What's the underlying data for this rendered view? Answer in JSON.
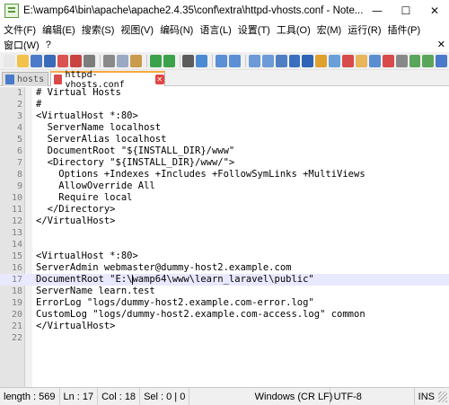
{
  "window": {
    "title": "E:\\wamp64\\bin\\apache\\apache2.4.35\\conf\\extra\\httpd-vhosts.conf - Note...",
    "minimize": "—",
    "maximize": "☐",
    "close": "✕"
  },
  "menu": {
    "row1": [
      "文件(F)",
      "编辑(E)",
      "搜索(S)",
      "视图(V)",
      "编码(N)",
      "语言(L)",
      "设置(T)",
      "工具(O)",
      "宏(M)",
      "运行(R)",
      "插件(P)"
    ],
    "row2": [
      "窗口(W)",
      "?"
    ],
    "close": "✕"
  },
  "toolbar": {
    "icons": [
      {
        "name": "new-file-icon",
        "color": "#e8e8e8"
      },
      {
        "name": "open-file-icon",
        "color": "#f3c24a"
      },
      {
        "name": "save-icon",
        "color": "#4a7ac9"
      },
      {
        "name": "save-all-icon",
        "color": "#3b6ab8"
      },
      {
        "name": "close-icon",
        "color": "#d9534f"
      },
      {
        "name": "close-all-icon",
        "color": "#c94440"
      },
      {
        "name": "print-icon",
        "color": "#7d7d7d"
      },
      {
        "sep": true
      },
      {
        "name": "cut-icon",
        "color": "#8a8a8a"
      },
      {
        "name": "copy-icon",
        "color": "#9aa9c4"
      },
      {
        "name": "paste-icon",
        "color": "#c99b4d"
      },
      {
        "sep": true
      },
      {
        "name": "undo-icon",
        "color": "#3aa24a"
      },
      {
        "name": "redo-icon",
        "color": "#3aa24a"
      },
      {
        "sep": true
      },
      {
        "name": "find-icon",
        "color": "#5c5c5c"
      },
      {
        "name": "replace-icon",
        "color": "#4c8bd1"
      },
      {
        "sep": true
      },
      {
        "name": "zoom-in-icon",
        "color": "#5b8fd6"
      },
      {
        "name": "zoom-out-icon",
        "color": "#5b8fd6"
      },
      {
        "sep": true
      },
      {
        "name": "sync-vertical-icon",
        "color": "#6c9bd8"
      },
      {
        "name": "sync-horizontal-icon",
        "color": "#6c9bd8"
      },
      {
        "name": "word-wrap-icon",
        "color": "#4d7fc2"
      },
      {
        "name": "show-all-chars-icon",
        "color": "#3a6fc0"
      },
      {
        "name": "indent-guide-icon",
        "color": "#2f63b7"
      },
      {
        "name": "user-language-icon",
        "color": "#e0a02e"
      },
      {
        "name": "document-map-icon",
        "color": "#6aa0d8"
      },
      {
        "name": "function-list-icon",
        "color": "#d94a4a"
      },
      {
        "name": "folder-workspace-icon",
        "color": "#e7b65a"
      },
      {
        "name": "monitoring-icon",
        "color": "#5a8ed0"
      },
      {
        "name": "record-macro-icon",
        "color": "#d94a4a"
      },
      {
        "name": "stop-record-icon",
        "color": "#888888"
      },
      {
        "name": "play-macro-icon",
        "color": "#5ba55b"
      },
      {
        "name": "run-macro-icon",
        "color": "#5ba55b"
      },
      {
        "name": "save-macro-icon",
        "color": "#4a7ac9"
      }
    ]
  },
  "tabs": [
    {
      "label": "hosts",
      "active": false,
      "icon_color": "#4a7ac9"
    },
    {
      "label": "httpd-vhosts.conf",
      "active": true,
      "icon_color": "#d94a4a"
    }
  ],
  "editor": {
    "current_line": 17,
    "caret_col": 18,
    "lines": [
      "# Virtual Hosts",
      "#",
      "<VirtualHost *:80>",
      "  ServerName localhost",
      "  ServerAlias localhost",
      "  DocumentRoot \"${INSTALL_DIR}/www\"",
      "  <Directory \"${INSTALL_DIR}/www/\">",
      "    Options +Indexes +Includes +FollowSymLinks +MultiViews",
      "    AllowOverride All",
      "    Require local",
      "  </Directory>",
      "</VirtualHost>",
      "",
      "",
      "<VirtualHost *:80>",
      "ServerAdmin webmaster@dummy-host2.example.com",
      "DocumentRoot \"E:\\wamp64\\www\\learn_laravel\\public\"",
      "ServerName learn.test",
      "ErrorLog \"logs/dummy-host2.example.com-error.log\"",
      "CustomLog \"logs/dummy-host2.example.com-access.log\" common",
      "</VirtualHost>",
      ""
    ]
  },
  "status": {
    "length": "length : 569",
    "ln": "Ln : 17",
    "col": "Col : 18",
    "sel": "Sel : 0 | 0",
    "eol": "Windows (CR LF)",
    "encoding": "UTF-8",
    "mode": "INS"
  }
}
